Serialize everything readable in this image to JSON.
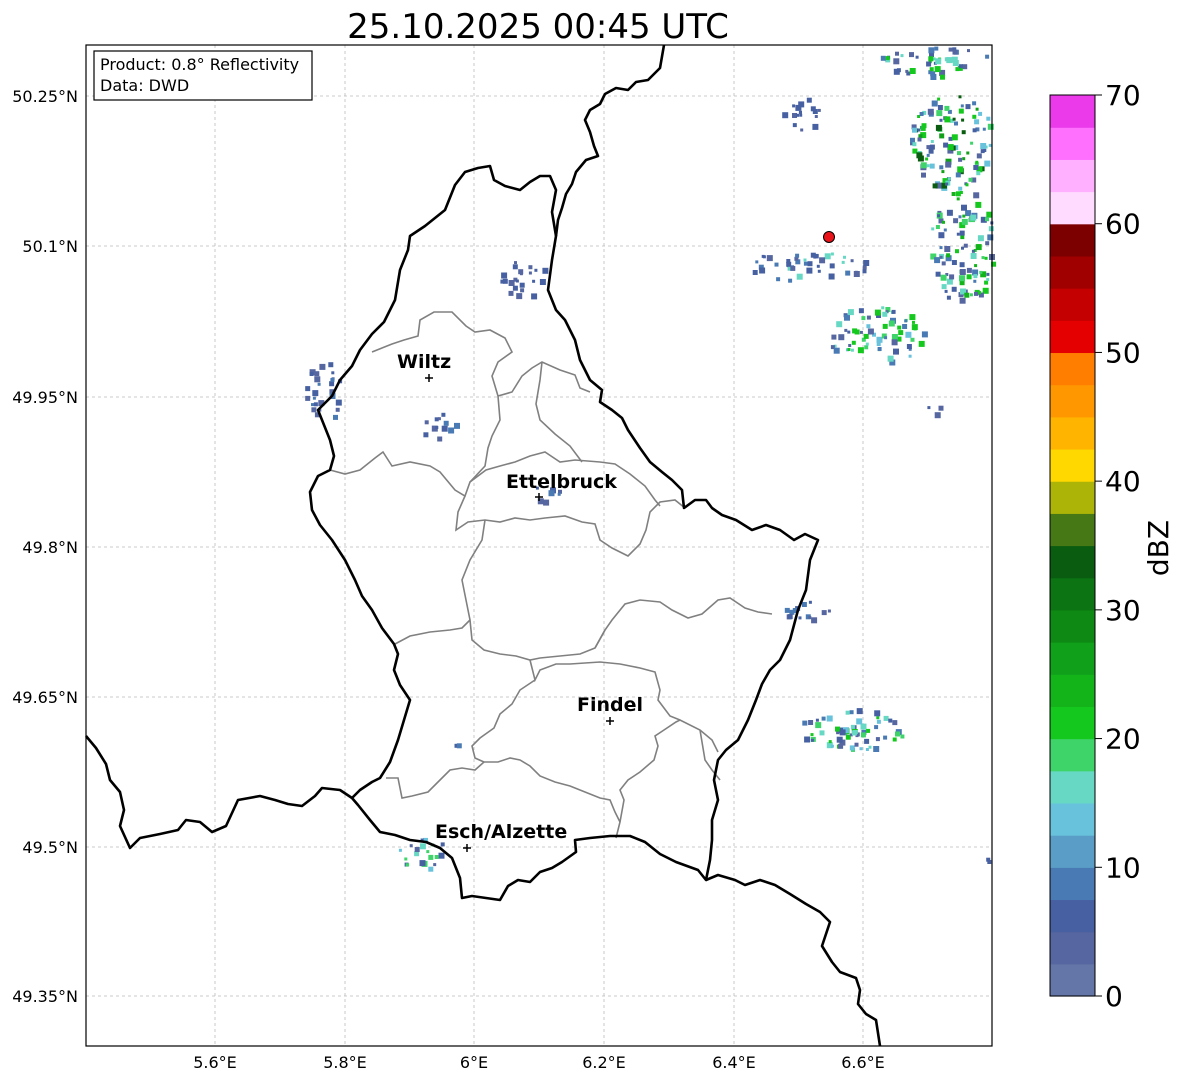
{
  "title": "25.10.2025 00:45 UTC",
  "info_box": {
    "line1": "Product: 0.8° Reflectivity",
    "line2": "Data: DWD"
  },
  "lon_ticks": [
    "5.6°E",
    "5.8°E",
    "6°E",
    "6.2°E",
    "6.4°E",
    "6.6°E"
  ],
  "lat_ticks": [
    "50.25°N",
    "50.1°N",
    "49.95°N",
    "49.8°N",
    "49.65°N",
    "49.5°N",
    "49.35°N"
  ],
  "cities": [
    {
      "name": "Wiltz"
    },
    {
      "name": "Ettelbruck"
    },
    {
      "name": "Findel"
    },
    {
      "name": "Esch/Alzette"
    }
  ],
  "colorbar": {
    "label": "dBZ",
    "ticks": [
      "0",
      "10",
      "20",
      "30",
      "40",
      "50",
      "60",
      "70"
    ],
    "colors": [
      "#6476a8",
      "#5566a0",
      "#4660a2",
      "#4a7ab4",
      "#5a9ec8",
      "#68c2dc",
      "#66d8c4",
      "#3ed46a",
      "#14c81e",
      "#12b41a",
      "#10a01a",
      "#0e8a14",
      "#0c7412",
      "#0a5c10",
      "#467816",
      "#acb408",
      "#ffd800",
      "#ffb400",
      "#ff9800",
      "#ff7e00",
      "#e40000",
      "#c40000",
      "#a00000",
      "#7c0000",
      "#ffdcff",
      "#ffb0ff",
      "#ff70ff",
      "#ea3aea"
    ]
  },
  "colors": {
    "border": "#000000",
    "cantons": "#808080",
    "grid": "#bbbbbb",
    "radar_site": "#e8141a"
  }
}
